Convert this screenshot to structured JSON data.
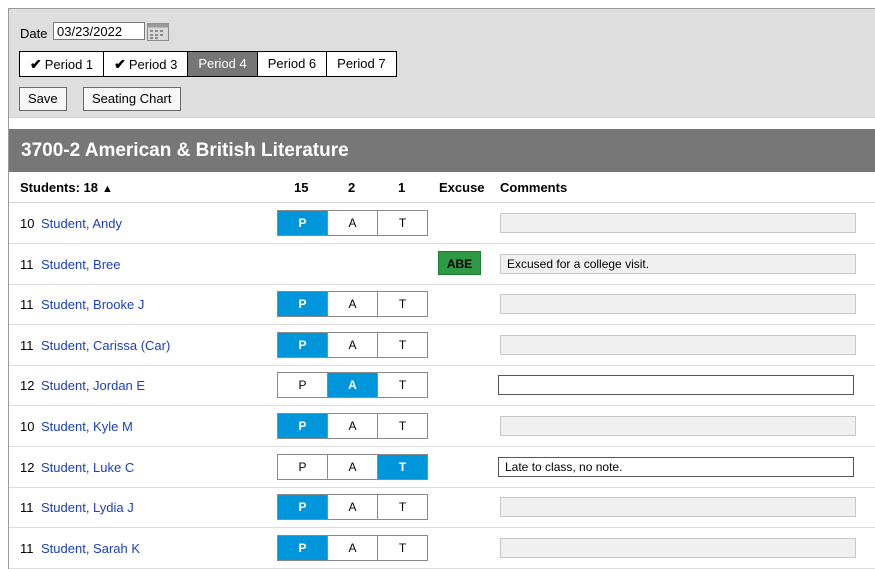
{
  "toolbar": {
    "date_label": "Date",
    "date_value": "03/23/2022",
    "periods": [
      {
        "label": "Period 1",
        "checked": true,
        "active": false
      },
      {
        "label": "Period 3",
        "checked": true,
        "active": false
      },
      {
        "label": "Period 4",
        "checked": false,
        "active": true
      },
      {
        "label": "Period 6",
        "checked": false,
        "active": false
      },
      {
        "label": "Period 7",
        "checked": false,
        "active": false
      }
    ],
    "save_label": "Save",
    "seating_chart_label": "Seating Chart"
  },
  "section": {
    "title": "3700-2 American & British Literature"
  },
  "table": {
    "headers": {
      "students": "Students: 18",
      "present_count": "15",
      "absent_count": "2",
      "tardy_count": "1",
      "excuse": "Excuse",
      "comments": "Comments"
    },
    "rows": [
      {
        "grade": "10",
        "name": "Student, Andy",
        "status": "P",
        "excuse": "",
        "comment": "",
        "comment_active": false
      },
      {
        "grade": "11",
        "name": "Student, Bree",
        "status": "",
        "excuse": "ABE",
        "comment": "Excused for a college visit.",
        "comment_active": false
      },
      {
        "grade": "11",
        "name": "Student, Brooke J",
        "status": "P",
        "excuse": "",
        "comment": "",
        "comment_active": false
      },
      {
        "grade": "11",
        "name": "Student, Carissa (Car)",
        "status": "P",
        "excuse": "",
        "comment": "",
        "comment_active": false
      },
      {
        "grade": "12",
        "name": "Student, Jordan E",
        "status": "A",
        "excuse": "",
        "comment": "",
        "comment_active": true
      },
      {
        "grade": "10",
        "name": "Student, Kyle M",
        "status": "P",
        "excuse": "",
        "comment": "",
        "comment_active": false
      },
      {
        "grade": "12",
        "name": "Student, Luke C",
        "status": "T",
        "excuse": "",
        "comment": "Late to class, no note.",
        "comment_active": true
      },
      {
        "grade": "11",
        "name": "Student, Lydia J",
        "status": "P",
        "excuse": "",
        "comment": "",
        "comment_active": false
      },
      {
        "grade": "11",
        "name": "Student, Sarah K",
        "status": "P",
        "excuse": "",
        "comment": "",
        "comment_active": false
      }
    ],
    "status_options": [
      "P",
      "A",
      "T"
    ]
  },
  "colors": {
    "selected_status": "#0096db",
    "excuse_badge": "#2e9a45",
    "title_bar": "#777777",
    "active_period": "#767676",
    "link": "#1a3fb8"
  }
}
